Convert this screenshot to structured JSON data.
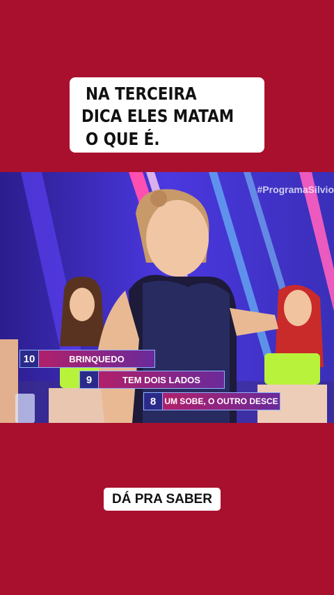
{
  "caption": {
    "line1": "NA TERCEIRA",
    "line2": "DICA ELES MATAM",
    "line3": "O QUE É."
  },
  "video": {
    "watermark": "#ProgramaSilvio",
    "clues": [
      {
        "number": "10",
        "text": "BRINQUEDO"
      },
      {
        "number": "9",
        "text": "TEM DOIS LADOS"
      },
      {
        "number": "8",
        "text": "UM SOBE, O OUTRO DESCE"
      }
    ]
  },
  "bottom_label": "DÁ PRA SABER",
  "colors": {
    "background": "#a8102e",
    "stage": "#4a2fd6",
    "neon_pink": "#ff3aa0"
  }
}
